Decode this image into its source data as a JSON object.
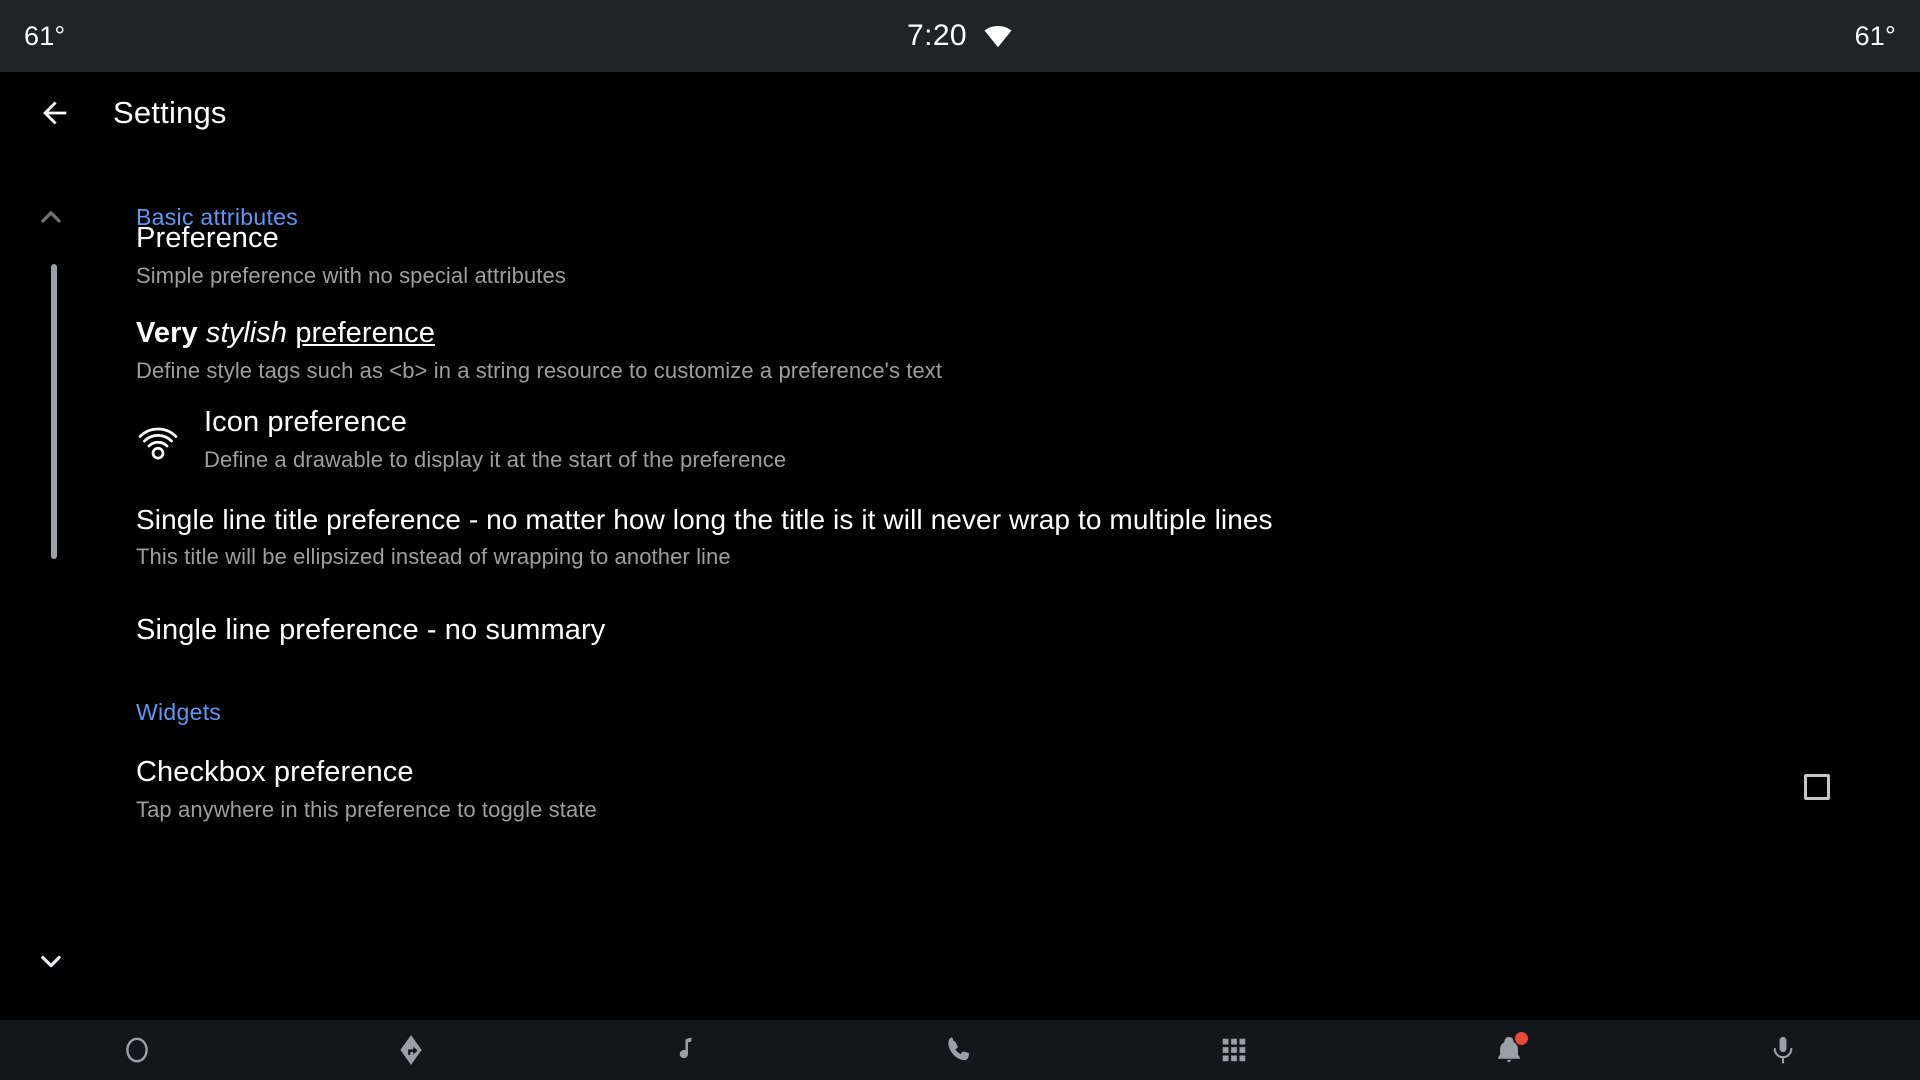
{
  "status_bar": {
    "left_temperature": "61°",
    "right_temperature": "61°",
    "clock": "7:20",
    "wifi_icon": "wifi-icon"
  },
  "app_bar": {
    "back_icon": "back-arrow-icon",
    "title": "Settings"
  },
  "sections": [
    {
      "header": "Basic attributes",
      "chevron_icon": "chevron-up-icon"
    },
    {
      "header": "Widgets",
      "chevron_icon": "chevron-down-icon"
    }
  ],
  "preferences": [
    {
      "title": "Preference",
      "summary": "Simple preference with no special attributes"
    },
    {
      "title_parts": {
        "bold": "Very",
        "italic": "stylish",
        "underline": "preference"
      },
      "title_plain": "Very stylish preference",
      "summary": "Define style tags such as <b> in a string resource to customize a preference's text"
    },
    {
      "icon": "wifi-tethering-icon",
      "title": "Icon preference",
      "summary": "Define a drawable to display it at the start of the preference"
    },
    {
      "title": "Single line title preference - no matter how long the title is it will never wrap to multiple lines",
      "summary": "This title will be ellipsized instead of wrapping to another line"
    },
    {
      "title": "Single line preference - no summary",
      "summary": ""
    },
    {
      "title": "Checkbox preference",
      "summary": "Tap anywhere in this preference to toggle state",
      "widget": "checkbox",
      "checked": false
    }
  ],
  "bottom_nav": [
    {
      "icon": "home-circle-icon",
      "label": "Home"
    },
    {
      "icon": "navigation-arrow-icon",
      "label": "Navigation"
    },
    {
      "icon": "music-note-icon",
      "label": "Media"
    },
    {
      "icon": "phone-icon",
      "label": "Phone"
    },
    {
      "icon": "apps-grid-icon",
      "label": "Apps"
    },
    {
      "icon": "bell-icon",
      "label": "Notifications",
      "badge": true
    },
    {
      "icon": "microphone-icon",
      "label": "Assistant"
    }
  ],
  "colors": {
    "status_bar_bg": "#212427",
    "content_bg": "#000000",
    "bottom_bar_bg": "#14171a",
    "accent_blue": "#5e97f6",
    "summary_gray": "#9e9e9e",
    "badge_red": "#e8493a"
  }
}
